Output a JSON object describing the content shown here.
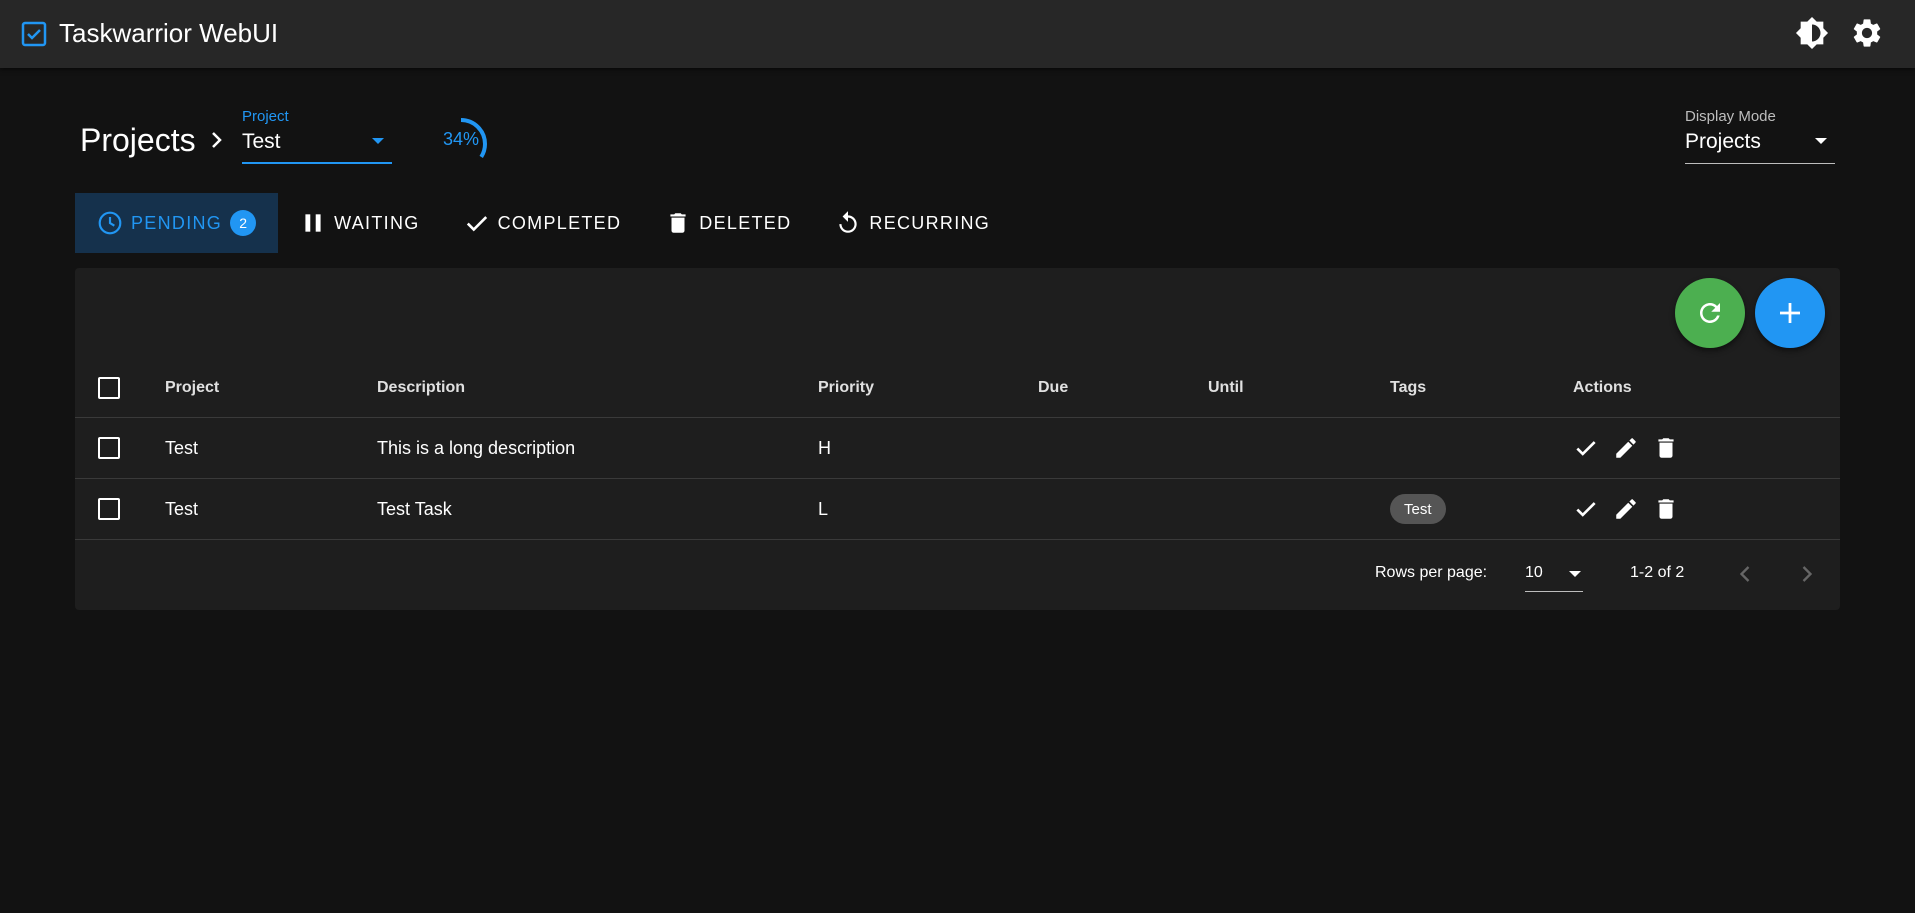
{
  "app": {
    "title": "Taskwarrior WebUI",
    "icons": [
      "checkbox-logo-icon",
      "theme-toggle-icon",
      "settings-gear-icon"
    ]
  },
  "header": {
    "title": "Projects",
    "project_select": {
      "label": "Project",
      "value": "Test"
    },
    "progress": {
      "text": "34%",
      "value_fraction": 0.34
    },
    "display_mode": {
      "label": "Display Mode",
      "value": "Projects"
    }
  },
  "tabs": [
    {
      "label": "PENDING",
      "icon": "clock-icon",
      "badge": "2",
      "active": true
    },
    {
      "label": "WAITING",
      "icon": "pause-icon"
    },
    {
      "label": "COMPLETED",
      "icon": "check-icon"
    },
    {
      "label": "DELETED",
      "icon": "trash-icon"
    },
    {
      "label": "RECURRING",
      "icon": "restart-icon"
    }
  ],
  "table": {
    "columns": {
      "project": "Project",
      "description": "Description",
      "priority": "Priority",
      "due": "Due",
      "until": "Until",
      "tags": "Tags",
      "actions": "Actions"
    },
    "rows": [
      {
        "project": "Test",
        "description": "This is a long description",
        "priority": "H",
        "due": "",
        "until": "",
        "tags": []
      },
      {
        "project": "Test",
        "description": "Test Task",
        "priority": "L",
        "due": "",
        "until": "",
        "tags": [
          "Test"
        ]
      }
    ]
  },
  "pagination": {
    "rows_per_page_label": "Rows per page:",
    "rows_per_page": "10",
    "range": "1-2 of 2"
  },
  "colors": {
    "accent": "#2196f3",
    "refresh_fab": "#4caf50",
    "background": "#121212",
    "surface": "#1e1e1e",
    "appbar": "#272727"
  }
}
